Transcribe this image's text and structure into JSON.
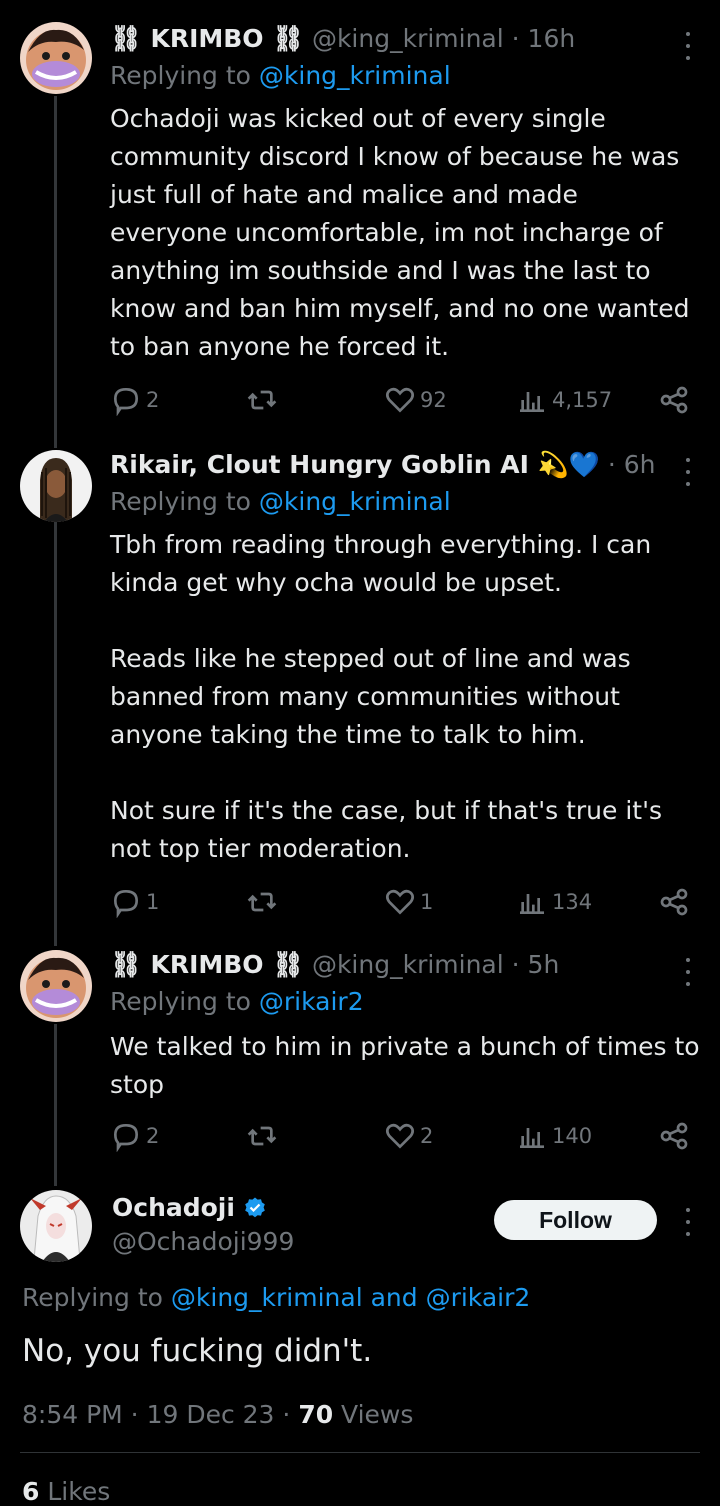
{
  "tweets": [
    {
      "name": "⛓ KRIMBO ⛓",
      "handle": "@king_kriminal",
      "time": "· 16h",
      "replying_prefix": "Replying to ",
      "replying_to": "@king_kriminal",
      "text": "Ochadoji was kicked out of every single community discord I know of because he was just full of hate and malice and made everyone uncomfortable, im not incharge of anything im southside and I was the last to know and ban him myself, and no one wanted to ban anyone he forced it.",
      "replies": "2",
      "reposts": "",
      "likes": "92",
      "views": "4,157"
    },
    {
      "name": "Rikair, Clout Hungry Goblin AI 💫💙",
      "handle": "",
      "time": "· 6h",
      "replying_prefix": "Replying to ",
      "replying_to": "@king_kriminal",
      "text_lines": [
        "Tbh from reading through everything. I can kinda get why ocha would be upset.",
        "",
        "Reads like he stepped out of line and was banned from many communities without anyone taking the time to talk to him.",
        "",
        "Not sure if it's the case, but if that's true it's not top tier moderation."
      ],
      "replies": "1",
      "reposts": "",
      "likes": "1",
      "views": "134"
    },
    {
      "name": "⛓ KRIMBO ⛓",
      "handle": "@king_kriminal",
      "time": "· 5h",
      "replying_prefix": "Replying to ",
      "replying_to": "@rikair2",
      "text": "We talked to him in private a bunch of times to stop",
      "replies": "2",
      "reposts": "",
      "likes": "2",
      "views": "140"
    }
  ],
  "main_tweet": {
    "name": "Ochadoji",
    "handle": "@Ochadoji999",
    "follow_label": "Follow",
    "replying_prefix": "Replying to ",
    "replying_to": "@king_kriminal and @rikair2",
    "text": "No, you fucking didn't.",
    "timestamp": "8:54 PM · 19 Dec 23 · ",
    "views_count": "70",
    "views_label": " Views",
    "likes_count": "6",
    "likes_label": " Likes"
  },
  "colors": {
    "background": "#000000",
    "text": "#e7e9ea",
    "muted": "#71767b",
    "link": "#1d9bf0",
    "verified": "#1d9bf0"
  },
  "icons": [
    "reply-icon",
    "repost-icon",
    "like-icon",
    "views-icon",
    "share-icon",
    "more-icon",
    "verified-badge-icon"
  ]
}
